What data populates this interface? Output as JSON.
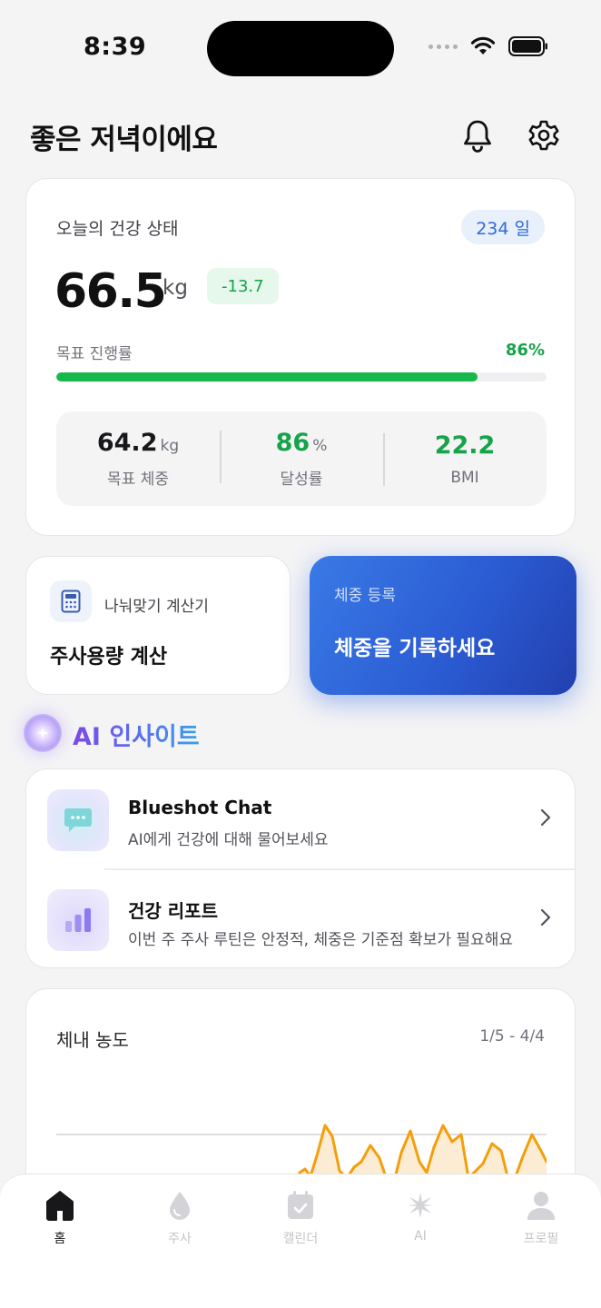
{
  "status_bar": {
    "time": "8:39"
  },
  "header": {
    "greeting": "좋은 저녁이에요"
  },
  "health_card": {
    "title": "오늘의 건강 상태",
    "days_badge": "234 일",
    "weight_value": "66.5",
    "weight_unit": "kg",
    "weight_delta": "-13.7",
    "goal_label": "목표 진행률",
    "goal_percent_text": "86%",
    "goal_progress": 0.86,
    "stats": [
      {
        "value": "64.2",
        "unit": "kg",
        "label": "목표 체중"
      },
      {
        "value": "86",
        "unit": "%",
        "label": "달성률"
      },
      {
        "value": "22.2",
        "unit": "",
        "label": "BMI"
      }
    ]
  },
  "calc_card": {
    "label": "나눠맞기 계산기",
    "title": "주사용량 계산"
  },
  "weigh_card": {
    "label": "체중 등록",
    "title": "체중을 기록하세요"
  },
  "ai_section": {
    "title": "AI 인사이트",
    "items": [
      {
        "title": "Blueshot Chat",
        "subtitle": "AI에게 건강에 대해 물어보세요"
      },
      {
        "title": "건강 리포트",
        "subtitle": "이번 주 주사 루틴은 안정적, 체중은 기준점 확보가 필요해요"
      }
    ]
  },
  "concentration_card": {
    "title": "체내 농도",
    "range": "1/5 - 4/4"
  },
  "tab_bar": {
    "tabs": [
      {
        "label": "홈",
        "icon": "home-icon",
        "active": true
      },
      {
        "label": "주사",
        "icon": "drop-icon",
        "active": false
      },
      {
        "label": "캘린더",
        "icon": "calendar-icon",
        "active": false
      },
      {
        "label": "AI",
        "icon": "sparkle-icon",
        "active": false
      },
      {
        "label": "프로필",
        "icon": "person-icon",
        "active": false
      }
    ]
  },
  "colors": {
    "accent_blue": "#2f6bd8",
    "success_green": "#16a34a",
    "chart_orange": "#f59e0b"
  }
}
